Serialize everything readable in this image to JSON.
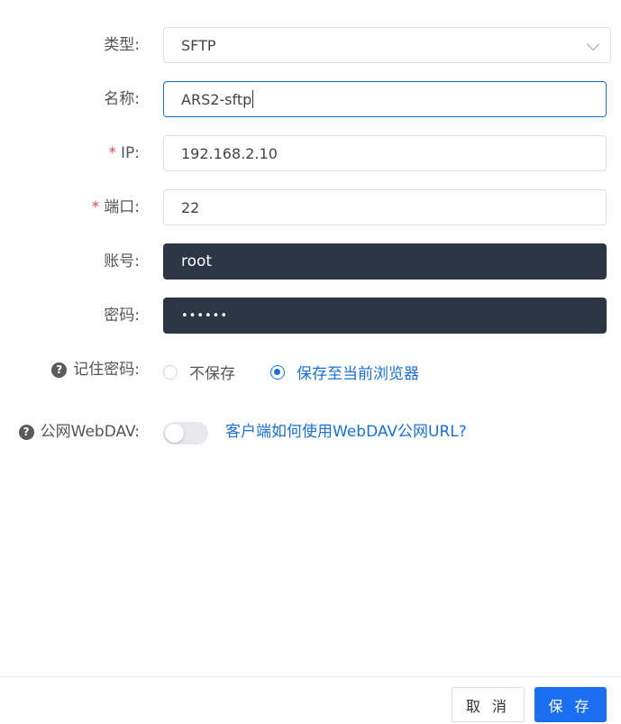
{
  "form": {
    "type": {
      "label": "类型:",
      "value": "SFTP"
    },
    "name": {
      "label": "名称:",
      "value": "ARS2-sftp"
    },
    "ip": {
      "required_mark": "*",
      "label": "IP:",
      "value": "192.168.2.10"
    },
    "port": {
      "required_mark": "*",
      "label": "端口:",
      "value": "22"
    },
    "account": {
      "label": "账号:",
      "value": "root"
    },
    "password": {
      "label": "密码:",
      "value": "••••••"
    },
    "remember": {
      "help": "?",
      "label": "记住密码:",
      "options": [
        "不保存",
        "保存至当前浏览器"
      ],
      "selected": "保存至当前浏览器"
    },
    "webdav": {
      "help": "?",
      "label": "公网WebDAV:",
      "enabled": false,
      "link_text": "客户端如何使用WebDAV公网URL?"
    }
  },
  "footer": {
    "cancel_label": "取 消",
    "save_label": "保 存"
  },
  "colors": {
    "primary": "#1a6ff0",
    "dark_field": "#2b3545",
    "required": "#e5484d"
  }
}
